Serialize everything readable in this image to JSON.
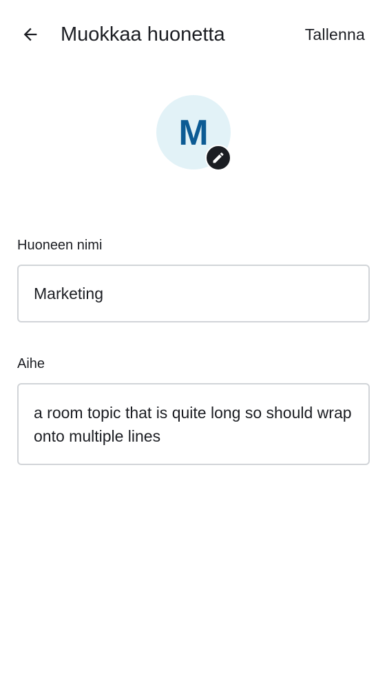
{
  "header": {
    "title": "Muokkaa huonetta",
    "save_label": "Tallenna",
    "back_icon": "arrow-left-icon"
  },
  "avatar": {
    "letter": "M",
    "background_color": "#e2f2f7",
    "letter_color": "#0c5b94",
    "edit_icon": "pencil-icon"
  },
  "form": {
    "room_name": {
      "label": "Huoneen nimi",
      "value": "Marketing"
    },
    "topic": {
      "label": "Aihe",
      "value": "a room topic that is quite long so should wrap onto multiple lines"
    }
  },
  "colors": {
    "text": "#1b1d22",
    "field_border": "#d1d4d8"
  }
}
